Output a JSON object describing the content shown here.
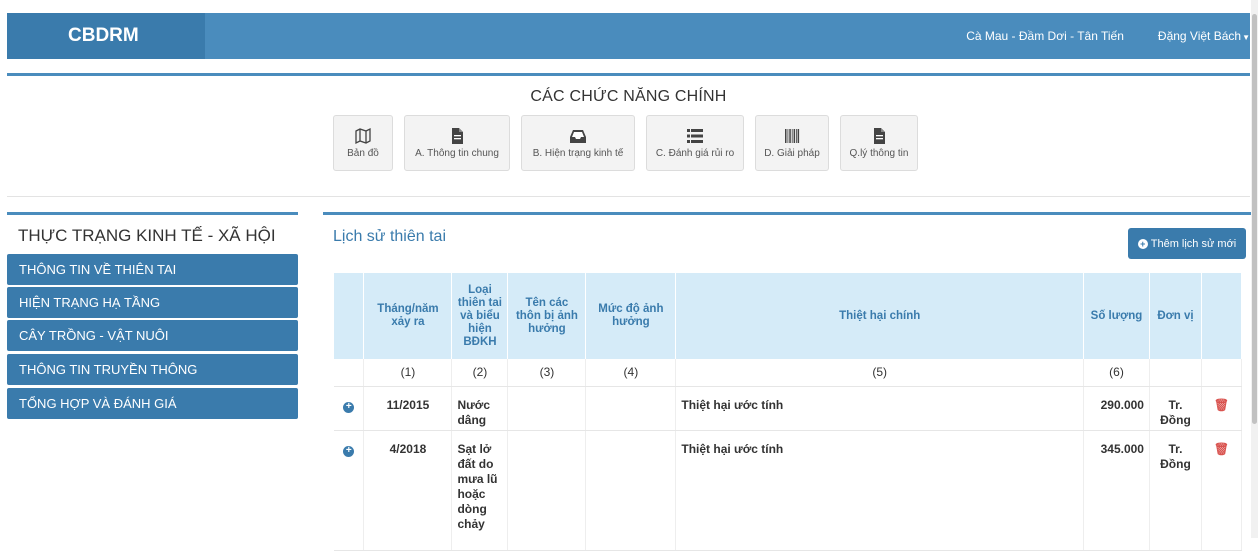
{
  "navbar": {
    "brand": "CBDRM",
    "location": "Cà Mau - Đầm Dơi - Tân Tiến",
    "user": "Đặng Việt Bách"
  },
  "functions": {
    "title": "CÁC CHỨC NĂNG CHÍNH",
    "buttons": [
      {
        "label": "Bản đồ",
        "icon": "map-icon"
      },
      {
        "label": "A. Thông tin chung",
        "icon": "file-icon"
      },
      {
        "label": "B. Hiện trạng kinh tế",
        "icon": "inbox-icon"
      },
      {
        "label": "C. Đánh giá rủi ro",
        "icon": "list-icon"
      },
      {
        "label": "D. Giải pháp",
        "icon": "barcode-icon"
      },
      {
        "label": "Q.lý thông tin",
        "icon": "file-icon"
      }
    ]
  },
  "sidebar": {
    "title": "THỰC TRẠNG KINH TẾ - XÃ HỘI",
    "items": [
      {
        "label": "THÔNG TIN VỀ THIÊN TAI"
      },
      {
        "label": "HIỆN TRẠNG HẠ TẦNG"
      },
      {
        "label": "CÂY TRỒNG - VẬT NUÔI"
      },
      {
        "label": "THÔNG TIN TRUYỀN THÔNG"
      },
      {
        "label": "TỔNG HỢP VÀ ĐÁNH GIÁ"
      }
    ]
  },
  "main": {
    "title": "Lịch sử thiên tai",
    "add_button": "Thêm lịch sử mới",
    "table": {
      "headers": [
        "Tháng/năm xảy ra",
        "Loại thiên tai và biểu hiện BĐKH",
        "Tên các thôn bị ảnh hưởng",
        "Mức độ ảnh hưởng",
        "Thiệt hại chính",
        "Số lượng",
        "Đơn vị"
      ],
      "numbers": [
        "(1)",
        "(2)",
        "(3)",
        "(4)",
        "(5)",
        "(6)"
      ],
      "rows": [
        {
          "date": "11/2015",
          "type": "Nước dâng",
          "villages": "",
          "level": "",
          "damage": "Thiệt hại ước tính",
          "qty": "290.000",
          "unit": "Tr. Đồng"
        },
        {
          "date": "4/2018",
          "type": "Sạt lở đất do mưa lũ hoặc dòng chảy",
          "villages": "",
          "level": "",
          "damage": "Thiệt hại ước tính",
          "qty": "345.000",
          "unit": "Tr. Đồng"
        }
      ]
    }
  }
}
